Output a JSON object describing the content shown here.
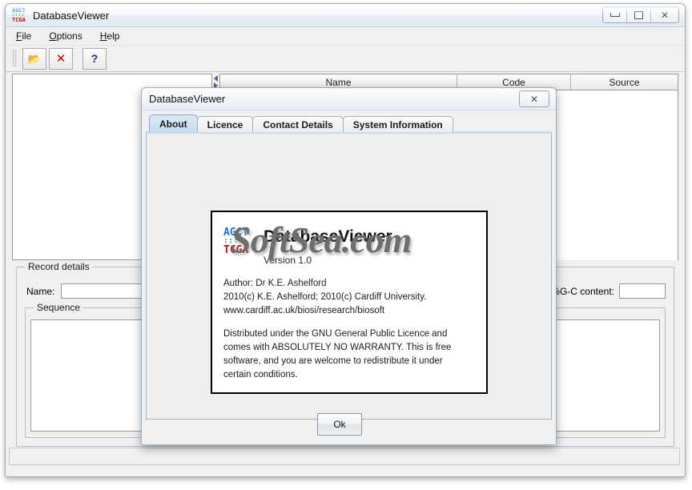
{
  "window": {
    "title": "DatabaseViewer",
    "logo": {
      "top": "AGCT",
      "mid": "::::",
      "bottom": "TCGA"
    },
    "controls": {
      "minimize": "minimize-button",
      "maximize": "maximize-button",
      "close": "✕"
    }
  },
  "menu": {
    "items": [
      {
        "mnemonic": "F",
        "rest": "ile"
      },
      {
        "mnemonic": "O",
        "rest": "ptions"
      },
      {
        "mnemonic": "H",
        "rest": "elp"
      }
    ]
  },
  "toolbar": {
    "open_icon": "📂",
    "delete_icon": "✕",
    "help_icon": "?"
  },
  "table": {
    "columns": [
      "Name",
      "Code",
      "Source"
    ],
    "rows": []
  },
  "record_details": {
    "group_label": "Record details",
    "name_label": "Name:",
    "name_value": "",
    "name_placeholder": "",
    "gc_label": "%G-C content:",
    "gc_value": "",
    "sequence_label": "Sequence",
    "sequence_value": ""
  },
  "status_bar": {
    "text": ""
  },
  "dialog": {
    "title": "DatabaseViewer",
    "close_glyph": "✕",
    "tabs": [
      {
        "label": "About",
        "active": true
      },
      {
        "label": "Licence",
        "active": false
      },
      {
        "label": "Contact Details",
        "active": false
      },
      {
        "label": "System Information",
        "active": false
      }
    ],
    "about": {
      "logo": {
        "top": "AGCT",
        "mid": "::::",
        "bottom": "TCGA"
      },
      "product": "DatabaseViewer",
      "version": "Version 1.0",
      "author": "Author: Dr K.E. Ashelford",
      "copyright": "2010(c) K.E. Ashelford; 2010(c) Cardiff University.",
      "website": "www.cardiff.ac.uk/biosi/research/biosoft",
      "licence_paragraph": "Distributed under the GNU General Public Licence and comes with ABSOLUTELY NO WARRANTY. This is free software, and you are welcome to redistribute it under certain conditions."
    },
    "ok_label": "Ok"
  },
  "watermark": {
    "text": "SoftSea.com"
  },
  "colors": {
    "window_bg": "#f0f0f0",
    "titlebar_top": "#fdfdfd",
    "active_tab": "#c7dcf0",
    "logo_blue": "#1f6fd0",
    "logo_green": "#1f9b2f",
    "logo_red": "#b01818",
    "delete_red": "#cc0000",
    "help_blue": "#1a2f8a"
  }
}
